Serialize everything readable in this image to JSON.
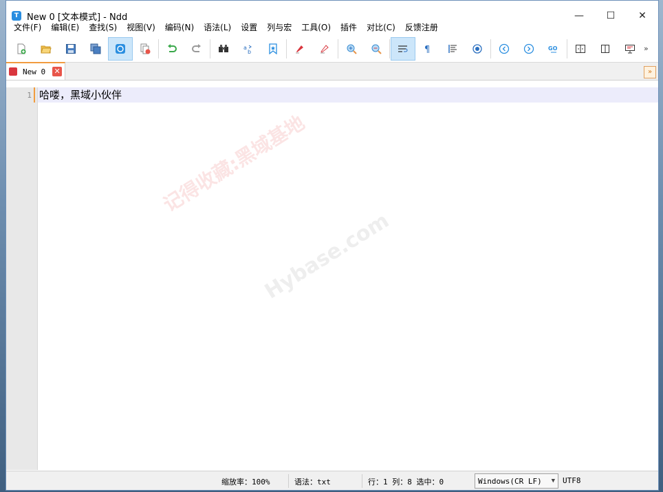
{
  "window": {
    "title": "New 0 [文本模式] - Ndd",
    "app_icon_letter": "T",
    "minimize": "—",
    "maximize": "☐",
    "close": "✕"
  },
  "menu": [
    "文件(F)",
    "编辑(E)",
    "查找(S)",
    "视图(V)",
    "编码(N)",
    "语法(L)",
    "设置",
    "列与宏",
    "工具(O)",
    "插件",
    "对比(C)",
    "反馈注册"
  ],
  "toolbar": {
    "icons": [
      "new-file-icon",
      "open-folder-icon",
      "save-icon",
      "save-all-icon",
      "sync-icon",
      "close-file-icon",
      "undo-icon",
      "redo-icon",
      "find-icon",
      "replace-icon",
      "bookmark-icon",
      "marker-icon",
      "eraser-icon",
      "zoom-in-icon",
      "zoom-out-icon",
      "wrap-icon",
      "show-symbols-icon",
      "indent-guide-icon",
      "record-icon",
      "prev-icon",
      "next-icon",
      "goto-icon",
      "split-icon",
      "compare-icon",
      "monitor-icon"
    ],
    "goto_label": "GO"
  },
  "tabs": [
    {
      "label": "New 0",
      "close": "✕"
    }
  ],
  "tab_overflow": "»",
  "editor": {
    "lines": [
      {
        "number": "1",
        "text": "哈喽，黑域小伙伴"
      }
    ]
  },
  "watermark": {
    "cn": "记得收藏:黑域基地",
    "en": "Hybase.com"
  },
  "status": {
    "zoom_label": "缩放率：100%",
    "syntax_label": "语法：txt",
    "position_label": "行：1 列：8 选中：0",
    "line_ending": "Windows(CR LF)",
    "encoding": "UTF8"
  },
  "colors": {
    "accent_orange": "#f29b3e",
    "active_button": "#cce6fa",
    "current_line": "#ececfb",
    "tab_close": "#e8554a"
  }
}
